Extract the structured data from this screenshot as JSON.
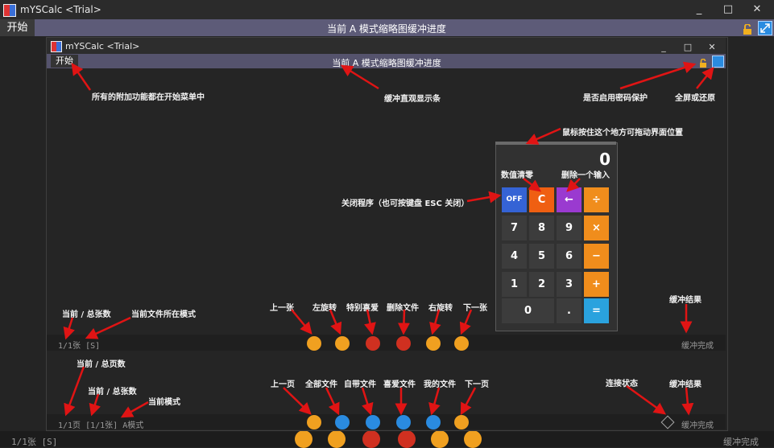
{
  "outer": {
    "title": "mYSCalc <Trial>",
    "start_label": "开始",
    "buffer_title": "当前 A 模式缩略图缓冲进度",
    "status_count": "1/1张 [S]",
    "status_right": "缓冲完成",
    "window_buttons": {
      "minimize": "_",
      "maximize": "□",
      "close": "✕"
    }
  },
  "inner": {
    "title": "mYSCalc <Trial>",
    "start_label": "开始",
    "buffer_title": "当前 A 模式缩略图缓冲进度",
    "status_top_left": "1/1张 [S]",
    "status_top_right": "缓冲完成",
    "status_bottom_left": "1/1页 [1/1张] A模式",
    "status_bottom_right": "缓冲完成"
  },
  "annotations": {
    "start_menu": "所有的附加功能都在开始菜单中",
    "buffer_bar": "缓冲直观显示条",
    "password": "是否启用密码保护",
    "fullscreen": "全屏或还原",
    "drag": "鼠标按住这个地方可拖动界面位置",
    "clear": "数值清零",
    "delete_one": "删除一个输入",
    "close_program": "关闭程序（也可按键盘 ESC 关闭）",
    "current_total": "当前 / 总张数",
    "file_mode": "当前文件所在模式",
    "prev": "上一张",
    "rotate_left": "左旋转",
    "favorite": "特别喜爱",
    "delete_file": "删除文件",
    "rotate_right": "右旋转",
    "next": "下一张",
    "buffer_result": "缓冲结果",
    "current_total_pages": "当前 / 总页数",
    "current_total_2": "当前 / 总张数",
    "current_mode": "当前模式",
    "prev_page": "上一页",
    "all_files": "全部文件",
    "own_files": "自带文件",
    "fav_files": "喜爱文件",
    "my_files": "我的文件",
    "next_page": "下一页",
    "connection": "连接状态",
    "buffer_result_2": "缓冲结果"
  },
  "calculator": {
    "display": "0",
    "keys": {
      "off": "OFF",
      "clear": "C",
      "backspace": "←",
      "divide": "÷",
      "k7": "7",
      "k8": "8",
      "k9": "9",
      "multiply": "×",
      "k4": "4",
      "k5": "5",
      "k6": "6",
      "minus": "−",
      "k1": "1",
      "k2": "2",
      "k3": "3",
      "plus": "+",
      "k0": "0",
      "dot": ".",
      "equals": "="
    }
  },
  "colors": {
    "menu_bar": "#5d5b78",
    "annotation_arrow": "#e01414",
    "btn_orange": "#f0a020",
    "btn_red": "#d03020",
    "btn_blue": "#2a8be0",
    "calc_orange": "#f08d1c",
    "calc_blue": "#2aa2de",
    "calc_off": "#3563d5",
    "calc_clear": "#ef5f12",
    "calc_del": "#9a3ad0"
  }
}
